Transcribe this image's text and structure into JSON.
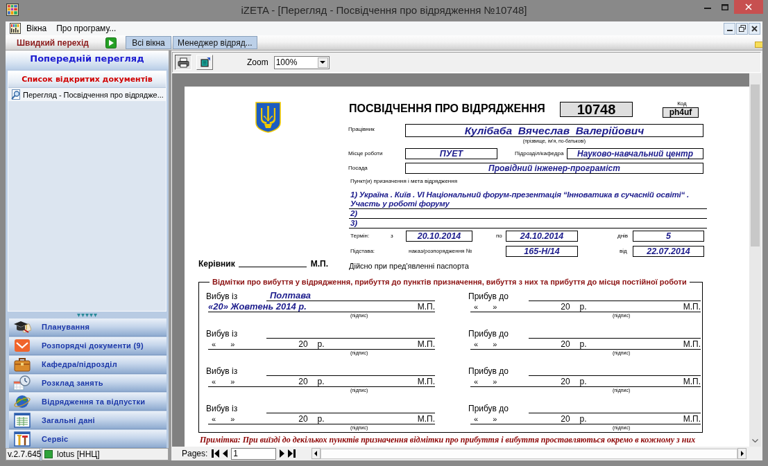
{
  "window": {
    "title": "iZETA - [Перегляд - Посвідчення про відрядження №10748]"
  },
  "menu": [
    "Вікна",
    "Про програму..."
  ],
  "toolbar": {
    "quick_nav_label": "Швидкий перехід",
    "buttons": [
      "Всі вікна",
      "Менеджер відряд..."
    ]
  },
  "sidebar": {
    "title": "Попередній перегляд",
    "open_documents": {
      "title": "Список відкритих документів",
      "items": [
        {
          "label": "Перегляд - Посвідчення про відрядже...",
          "selected": true
        }
      ]
    },
    "nav": [
      "Планування",
      "Розпорядчі документи (9)",
      "Кафедра/підрозділ",
      "Розклад занять",
      "Відрядження та відпустки",
      "Загальні дані",
      "Сервіс"
    ]
  },
  "preview": {
    "zoom_label": "Zoom",
    "zoom": "100%",
    "pages_label": "Pages:",
    "page": "1",
    "document": {
      "title": "ПОСВІДЧЕННЯ ПРО ВІДРЯДЖЕННЯ",
      "number": "10748",
      "code_label": "Код",
      "code": "ph4uf",
      "employee": {
        "label": "Працівник",
        "value": "Кулібаба  Вячеслав  Валерійович",
        "hint": "(прізвище, ім'я, по-батькові)"
      },
      "workplace": {
        "label": "Місце роботи",
        "value": "ПУЕТ"
      },
      "department": {
        "label": "Підрозділ/кафедра",
        "value": "Науково-навчальний центр"
      },
      "position": {
        "label": "Посада",
        "value": "Провідний інженер-програміст"
      },
      "destinations": {
        "label": "Пункт(и) призначення і мета відрядження",
        "items": [
          "1) Україна . Київ . VI Національний форум-презентація “Інноватика в сучасній освіті“ . Участь у роботі форуму",
          "2)",
          "3)"
        ]
      },
      "term": {
        "label": "Термін:",
        "from_label": "з",
        "from": "20.10.2014",
        "to_label": "по",
        "to": "24.10.2014",
        "days_label": "днів",
        "days": "5"
      },
      "basis": {
        "label": "Підстава:",
        "order_label": "наказ/розпорядження №",
        "order": "165-Н/14",
        "date_label": "від",
        "date": "22.07.2014"
      },
      "manager": {
        "label": "Керівник",
        "stamp": "М.П."
      },
      "validity": "Дійсно при пред'явленні паспорта",
      "marks": {
        "title": "Відмітки про вибуття у відрядження, прибуття до пунктів призначення, вибуття з них та прибуття до місця постійної роботи",
        "entries": [
          {
            "kind": "filled",
            "label": "Вибув із",
            "place": "Полтава",
            "date": "«20» Жовтень 2014 р.",
            "stamp": "М.П.",
            "signature": "(підпис)"
          },
          {
            "kind": "blank",
            "label": "Прибув до",
            "date_parts": [
              "«",
              "»",
              "20",
              "р."
            ],
            "stamp": "М.П.",
            "signature": "(підпис)"
          },
          {
            "kind": "blank",
            "label": "Вибув із",
            "date_parts": [
              "«",
              "»",
              "20",
              "р."
            ],
            "stamp": "М.П.",
            "signature": "(підпис)"
          },
          {
            "kind": "blank",
            "label": "Прибув до",
            "date_parts": [
              "«",
              "»",
              "20",
              "р."
            ],
            "stamp": "М.П.",
            "signature": "(підпис)"
          },
          {
            "kind": "blank",
            "label": "Вибув із",
            "date_parts": [
              "«",
              "»",
              "20",
              "р."
            ],
            "stamp": "М.П.",
            "signature": "(підпис)"
          },
          {
            "kind": "blank",
            "label": "Прибув до",
            "date_parts": [
              "«",
              "»",
              "20",
              "р."
            ],
            "stamp": "М.П.",
            "signature": "(підпис)"
          },
          {
            "kind": "blank",
            "label": "Вибув із",
            "date_parts": [
              "«",
              "»",
              "20",
              "р."
            ],
            "stamp": "М.П.",
            "signature": "(підпис)"
          },
          {
            "kind": "blank",
            "label": "Прибув до",
            "date_parts": [
              "«",
              "»",
              "20",
              "р."
            ],
            "stamp": "М.П.",
            "signature": "(підпис)"
          }
        ]
      },
      "note": "Примітка: При виїзді до декількох пунктів призначення відмітки про прибуття і вибуття проставляються окремо в кожному з них"
    }
  },
  "status_bar": {
    "version": "v.2.7.645",
    "connection": "lotus [ННЦ]"
  }
}
